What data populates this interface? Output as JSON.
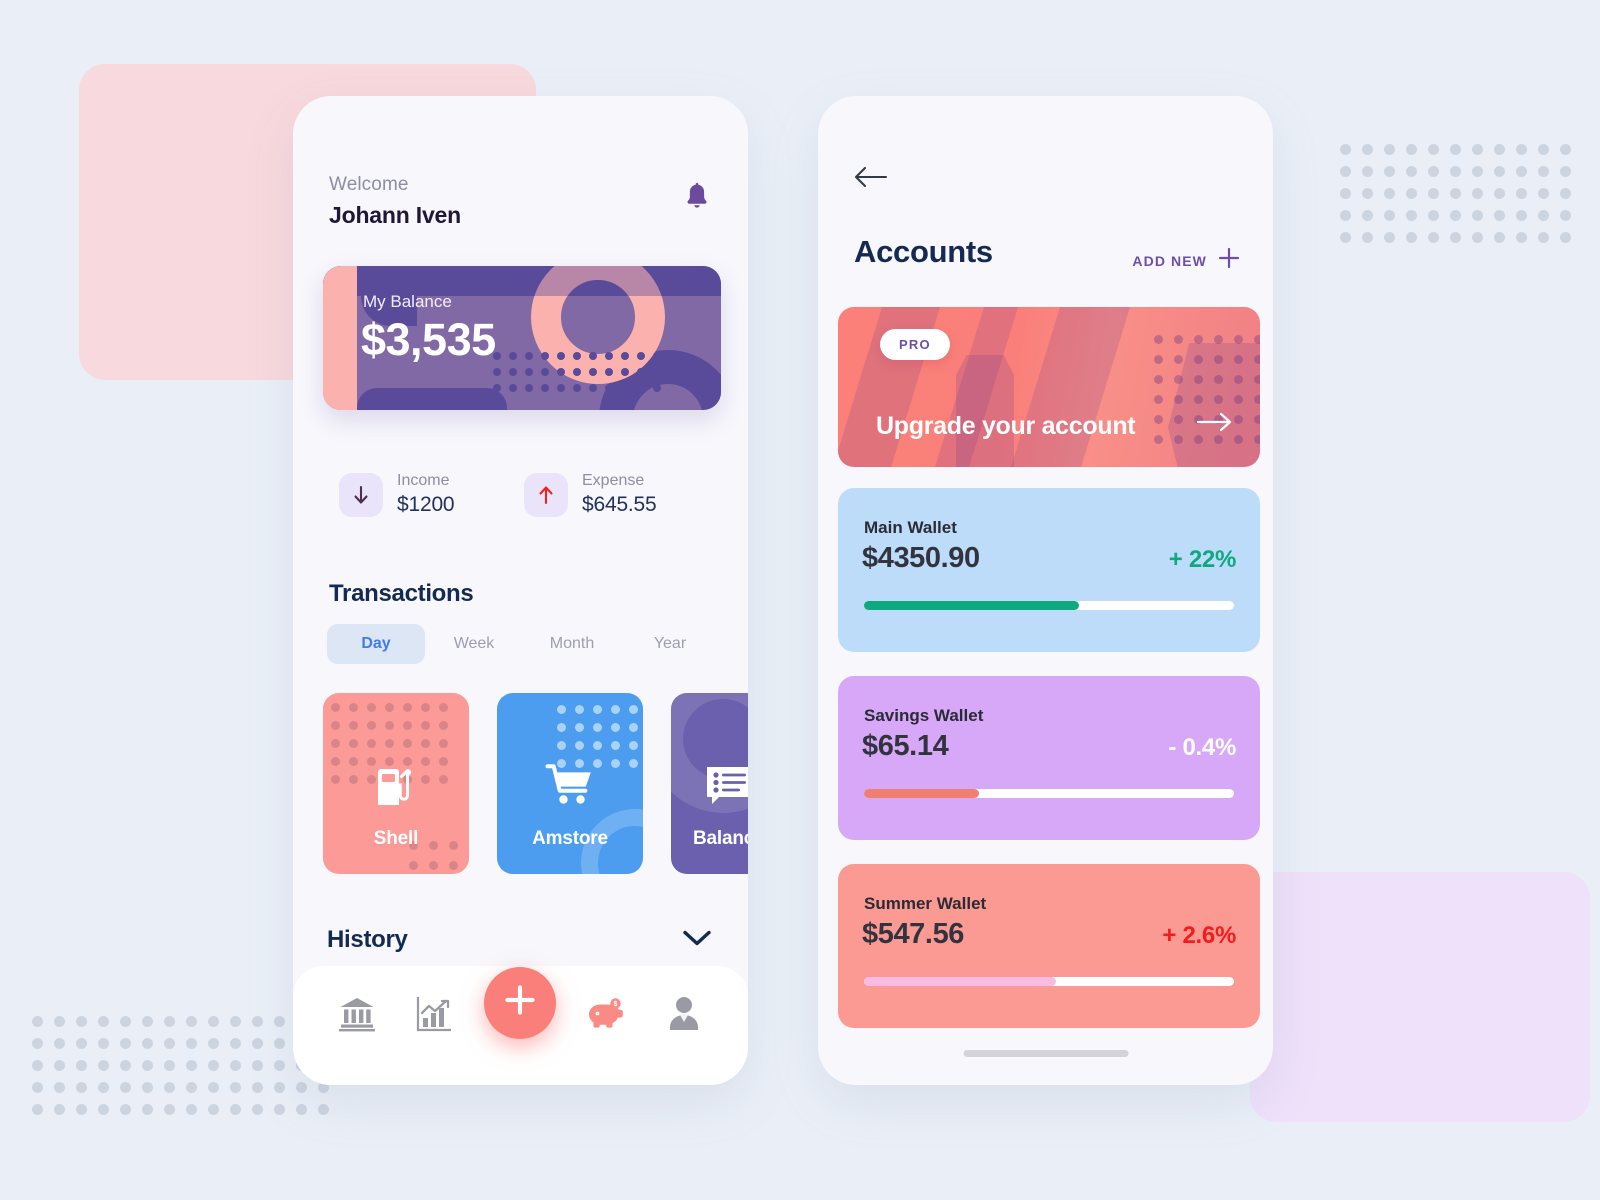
{
  "theme": {
    "page_bg": "#eaeff7",
    "phone_bg": "#f7f7fc",
    "accent_red": "#fa7e7a",
    "accent_purple": "#6d4fa8",
    "accent_blue": "#3e7cf0",
    "balance_card_bg": "#8069a4",
    "dot_grid": "#ccd4e0",
    "bg_pink_rect": "#f8d9dd",
    "bg_purple_rect": "#efe1fa"
  },
  "left_phone": {
    "header": {
      "welcome_label": "Welcome",
      "user_name": "Johann Iven",
      "notification_icon": "bell-icon"
    },
    "balance_card": {
      "label": "My Balance",
      "amount": "$3,535"
    },
    "stats": [
      {
        "icon": "arrow-down-icon",
        "label": "Income",
        "value": "$1200",
        "arrow_color": "#4a2f4f"
      },
      {
        "icon": "arrow-up-icon",
        "label": "Expense",
        "value": "$645.55",
        "arrow_color": "#f22121"
      }
    ],
    "transactions": {
      "title": "Transactions",
      "tabs": [
        {
          "label": "Day",
          "active": true
        },
        {
          "label": "Week",
          "active": false
        },
        {
          "label": "Month",
          "active": false
        },
        {
          "label": "Year",
          "active": false
        }
      ],
      "cards": [
        {
          "label": "Shell",
          "icon": "fuel-pump-icon",
          "color": "#fb9a96"
        },
        {
          "label": "Amstore",
          "icon": "shopping-cart-icon",
          "color": "#4c9df0"
        },
        {
          "label": "Balance",
          "icon": "list-bill-icon",
          "color": "#6a60ad"
        }
      ]
    },
    "history": {
      "title": "History",
      "expand_icon": "chevron-down-icon"
    },
    "bottom_nav": {
      "items": [
        {
          "icon": "bank-icon",
          "name": "bank"
        },
        {
          "icon": "chart-bars-icon",
          "name": "statistics"
        },
        {
          "icon": "plus-icon",
          "name": "add",
          "is_fab": true
        },
        {
          "icon": "piggy-bank-icon",
          "name": "savings"
        },
        {
          "icon": "user-avatar-icon",
          "name": "profile"
        }
      ]
    }
  },
  "right_phone": {
    "back_icon": "arrow-left-icon",
    "title": "Accounts",
    "add_new": {
      "label": "ADD NEW",
      "icon": "plus-icon"
    },
    "promo": {
      "badge": "PRO",
      "title": "Upgrade your account",
      "arrow_icon": "arrow-right-icon"
    },
    "wallets": [
      {
        "name": "Main Wallet",
        "amount": "$4350.90",
        "change": "+ 22%",
        "change_color": "#0fa97f",
        "progress_percent": 58,
        "bar_color": "#0fa97f",
        "card_color": "#bcdcfa"
      },
      {
        "name": "Savings Wallet",
        "amount": "$65.14",
        "change": "- 0.4%",
        "change_color": "#ffffff",
        "progress_percent": 31,
        "bar_color": "#f07f72",
        "card_color": "#d6a8f7"
      },
      {
        "name": "Summer Wallet",
        "amount": "$547.56",
        "change": "+ 2.6%",
        "change_color": "#f51b1b",
        "progress_percent": 52,
        "bar_color": "#f8bbe4",
        "card_color": "#fa9a92"
      }
    ],
    "home_indicator": "home-indicator"
  }
}
